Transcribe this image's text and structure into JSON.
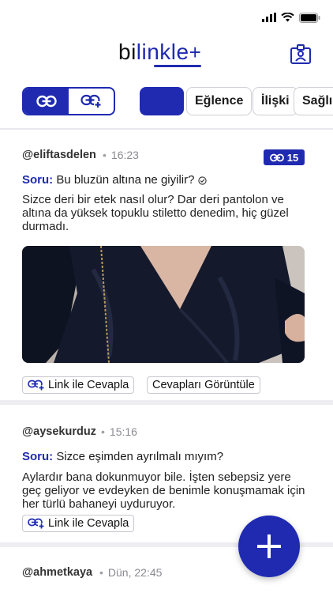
{
  "status_bar": {
    "time": ""
  },
  "header": {
    "logo_prefix": "bi",
    "logo_link": "linkle",
    "logo_plus": "+"
  },
  "filters": {
    "toggle": [
      {
        "icon": "link-icon",
        "active": true
      },
      {
        "icon": "add-link-icon",
        "active": false
      }
    ],
    "categories": [
      "",
      "Eğlence",
      "İlişki",
      "Sağlı"
    ]
  },
  "posts": [
    {
      "handle": "@eliftasdelen",
      "time": "16:23",
      "link_count": "15",
      "question_label": "Soru:",
      "question": "Bu bluzün altına ne giyilir?",
      "body": "Sizce deri bir etek nasıl olur? Dar deri pantolon ve altına da yüksek topuklu stiletto denedim, hiç güzel durmadı.",
      "actions": [
        "Link ile Cevapla",
        "Cevapları Görüntüle"
      ]
    },
    {
      "handle": "@aysekurduz",
      "time": "15:16",
      "question_label": "Soru:",
      "question": "Sizce eşimden ayrılmalı mıyım?",
      "body": "Aylardır bana dokunmuyor bile. İşten sebepsiz yere geç geliyor ve evdeyken de benimle konuşmamak için her türlü bahaneyi uyduruyor.",
      "actions": [
        "Link ile Cevapla"
      ]
    },
    {
      "handle": "@ahmetkaya",
      "time": "Dün, 22:45"
    }
  ],
  "fab_label": "+",
  "colors": {
    "accent": "#1f2ab1",
    "separator": "#ededf2"
  }
}
